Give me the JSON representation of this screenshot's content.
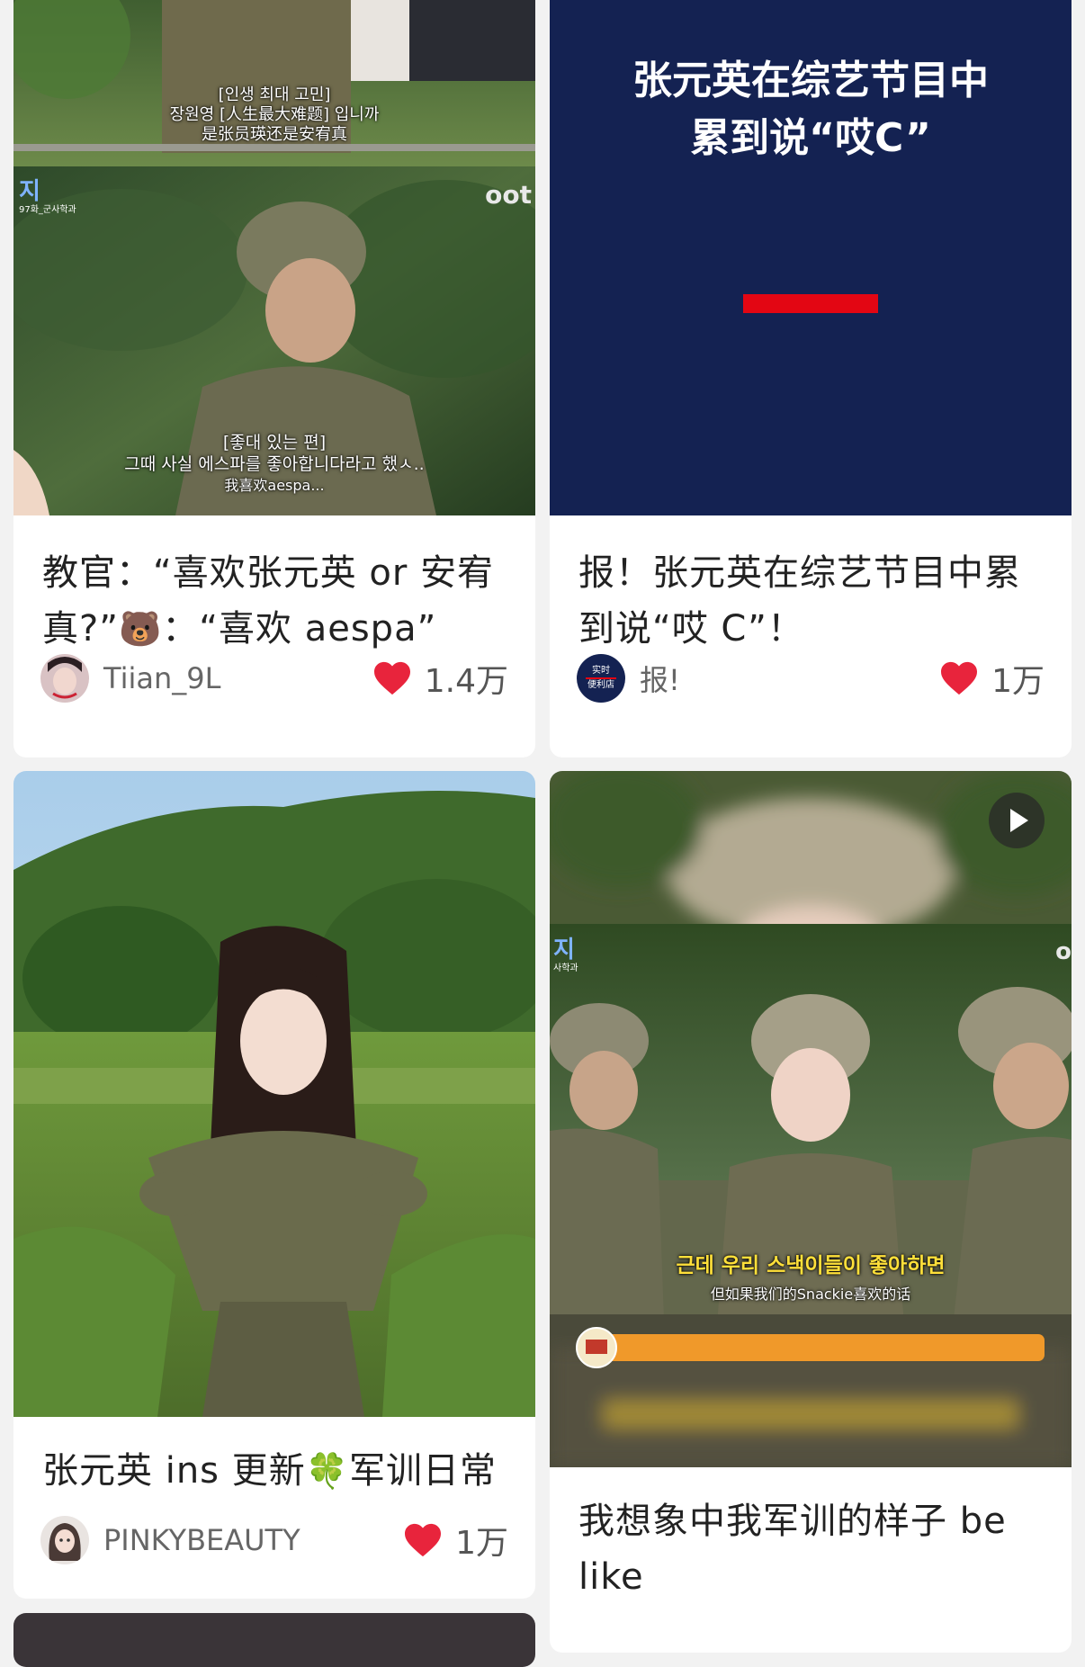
{
  "colors": {
    "like_heart": "#e8243c",
    "navy_poster": "#142252",
    "red_bar": "#e30613",
    "orange_bar": "#f0992a"
  },
  "icons": {
    "like": "heart-icon",
    "play": "play-icon"
  },
  "cards": [
    {
      "title_parts": [
        "教官：“喜欢张元英 or 安宥真?”",
        "🐻",
        "：“喜欢 aespa”"
      ],
      "author": "Tiian_9L",
      "likes": "1.4万",
      "captions": {
        "top_ko": "[인생 최대 고민]",
        "top_ko2": "장원영 [人生最大难题] 입니까",
        "top_zh": "是张员瑛还是安宥真",
        "corner_left": "지",
        "corner_left_sub": "97화_군사학과",
        "corner_right": "oot",
        "bottom_ko": "[좋대 있는 편]",
        "bottom_ko2": "그때 사실 에스파를 좋아합니다라고 했ㅅ..",
        "bottom_zh": "我喜欢aespa..."
      }
    },
    {
      "title": "报！张元英在综艺节目中累到说“哎 C”！",
      "author": "报!",
      "likes": "1万",
      "poster_line1": "张元英在综艺节目中",
      "poster_line2": "累到说“哎C”",
      "avatar_text1": "实时",
      "avatar_text2": "便利店"
    },
    {
      "title_parts": [
        "张元英 ins 更新",
        "🍀",
        "军训日常"
      ],
      "author": "PINKYBEAUTY",
      "likes": "1万"
    },
    {
      "title": "我想象中我军训的样子 be like",
      "captions": {
        "corner_left": "지",
        "corner_left_sub": "사학과",
        "corner_right": "o",
        "ko": "근데 우리 스낵이들이 좋아하면",
        "zh": "但如果我们的Snackie喜欢的话"
      }
    }
  ]
}
